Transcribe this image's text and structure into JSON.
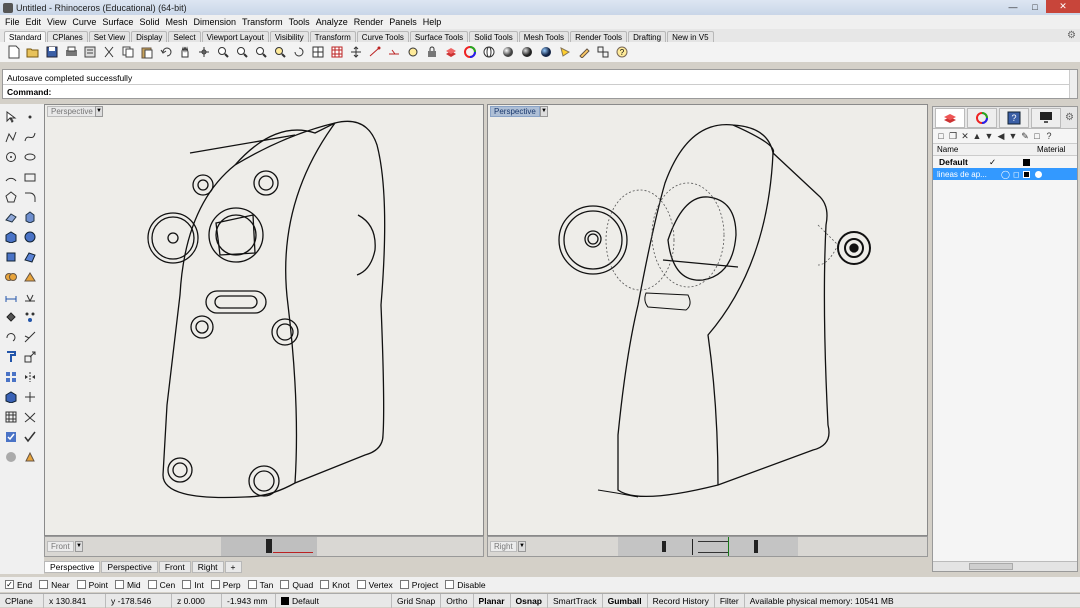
{
  "window": {
    "title": "Untitled - Rhinoceros (Educational) (64-bit)"
  },
  "menu": [
    "File",
    "Edit",
    "View",
    "Curve",
    "Surface",
    "Solid",
    "Mesh",
    "Dimension",
    "Transform",
    "Tools",
    "Analyze",
    "Render",
    "Panels",
    "Help"
  ],
  "toolbar_tabs": [
    "Standard",
    "CPlanes",
    "Set View",
    "Display",
    "Select",
    "Viewport Layout",
    "Visibility",
    "Transform",
    "Curve Tools",
    "Surface Tools",
    "Solid Tools",
    "Mesh Tools",
    "Render Tools",
    "Drafting",
    "New in V5"
  ],
  "active_toolbar_tab": "Standard",
  "command": {
    "history": "Autosave completed successfully",
    "prompt": "Command:"
  },
  "viewports": {
    "left": {
      "title": "Perspective",
      "selected": false
    },
    "right": {
      "title": "Perspective",
      "selected": true
    },
    "mini_left": {
      "title": "Front"
    },
    "mini_right": {
      "title": "Right"
    }
  },
  "viewport_tabs": [
    "Perspective",
    "Perspective",
    "Front",
    "Right",
    "+"
  ],
  "layers_panel": {
    "headers": {
      "name": "Name",
      "material": "Material"
    },
    "rows": [
      {
        "name": "Default",
        "current": "✓",
        "color": "#000000"
      },
      {
        "name": "lineas de ap...",
        "selected": true,
        "color": "#000000"
      }
    ]
  },
  "osnaps": [
    {
      "label": "End",
      "checked": true
    },
    {
      "label": "Near",
      "checked": false
    },
    {
      "label": "Point",
      "checked": false
    },
    {
      "label": "Mid",
      "checked": false
    },
    {
      "label": "Cen",
      "checked": false
    },
    {
      "label": "Int",
      "checked": false
    },
    {
      "label": "Perp",
      "checked": false
    },
    {
      "label": "Tan",
      "checked": false
    },
    {
      "label": "Quad",
      "checked": false
    },
    {
      "label": "Knot",
      "checked": false
    },
    {
      "label": "Vertex",
      "checked": false
    },
    {
      "label": "Project",
      "checked": false
    },
    {
      "label": "Disable",
      "checked": false
    }
  ],
  "status": {
    "cplane": "CPlane",
    "x": "x 130.841",
    "y": "y -178.546",
    "z": "z 0.000",
    "distance": "-1.943 mm",
    "layer": "Default",
    "grid_snap": "Grid Snap",
    "ortho": "Ortho",
    "planar": "Planar",
    "osnap": "Osnap",
    "smarttrack": "SmartTrack",
    "gumball": "Gumball",
    "record_history": "Record History",
    "filter": "Filter",
    "memory": "Available physical memory: 10541 MB"
  },
  "colors": {
    "selection": "#3399ff",
    "viewport_bg": "#eeede9",
    "active_viewport_title": "#aebfd6"
  }
}
